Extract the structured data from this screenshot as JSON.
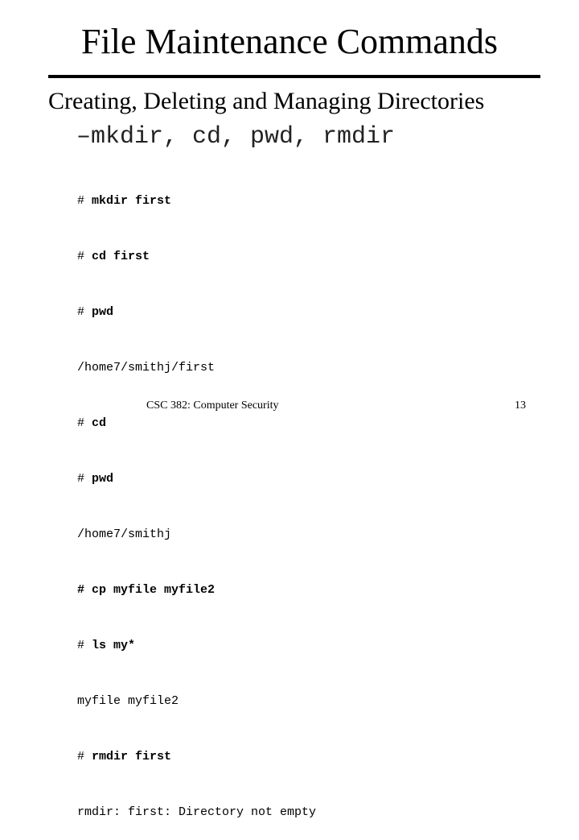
{
  "slide": {
    "title": "File Maintenance Commands",
    "heading": "Creating, Deleting and Managing Directories",
    "subheading": "–mkdir, cd, pwd, rmdir"
  },
  "terminal": {
    "lines": [
      {
        "prompt": "# ",
        "text": "mkdir first",
        "type": "command"
      },
      {
        "prompt": "# ",
        "text": "cd first",
        "type": "command"
      },
      {
        "prompt": "# ",
        "text": "pwd",
        "type": "command"
      },
      {
        "prompt": "",
        "text": "/home7/smithj/first",
        "type": "output"
      },
      {
        "prompt": "# ",
        "text": "cd",
        "type": "command"
      },
      {
        "prompt": "# ",
        "text": "pwd",
        "type": "command"
      },
      {
        "prompt": "",
        "text": "/home7/smithj",
        "type": "output"
      },
      {
        "prompt": "# ",
        "text": "cp myfile myfile2",
        "type": "command"
      },
      {
        "prompt": "# ",
        "text": "ls my*",
        "type": "command"
      },
      {
        "prompt": "",
        "text": "myfile myfile2",
        "type": "output"
      },
      {
        "prompt": "# ",
        "text": "rmdir first",
        "type": "command"
      },
      {
        "prompt": "",
        "text": "rmdir: first: Directory not empty",
        "type": "output"
      }
    ]
  },
  "footer": {
    "course": "CSC 382: Computer Security",
    "page_number": "13"
  }
}
